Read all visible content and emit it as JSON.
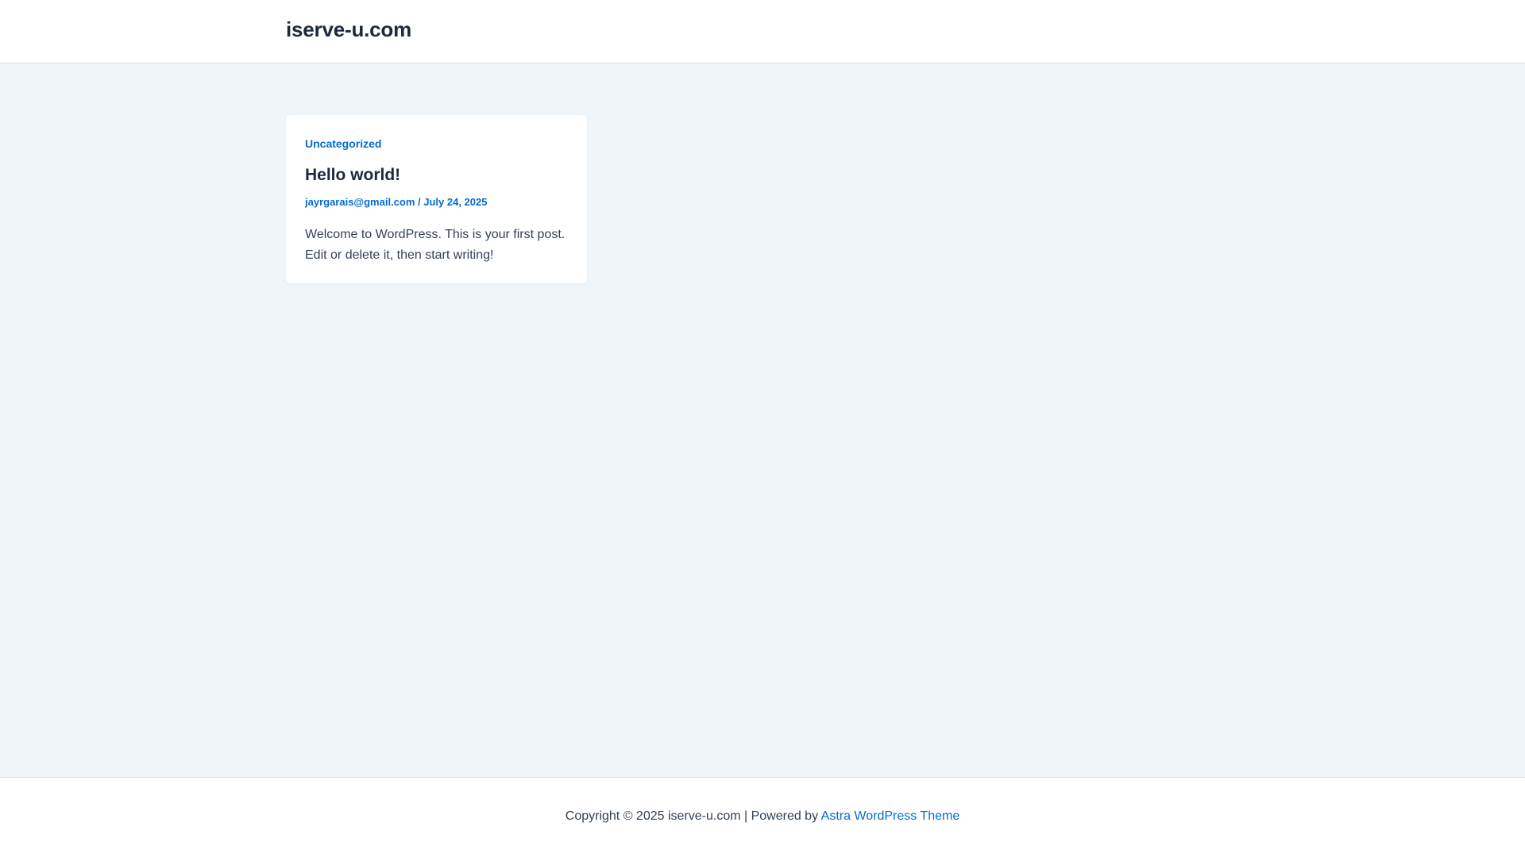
{
  "header": {
    "site_title": "iserve-u.com"
  },
  "post": {
    "category": "Uncategorized",
    "title": "Hello world!",
    "author": "jayrgarais@gmail.com",
    "meta_separator": " / ",
    "date": "July 24, 2025",
    "excerpt": "Welcome to WordPress. This is your first post. Edit or delete it, then start writing!"
  },
  "footer": {
    "copyright": "Copyright © 2025 iserve-u.com | Powered by ",
    "theme_link": "Astra WordPress Theme"
  },
  "colors": {
    "accent": "#046bd2",
    "heading": "#1e293b",
    "background": "#f0f5fa"
  }
}
